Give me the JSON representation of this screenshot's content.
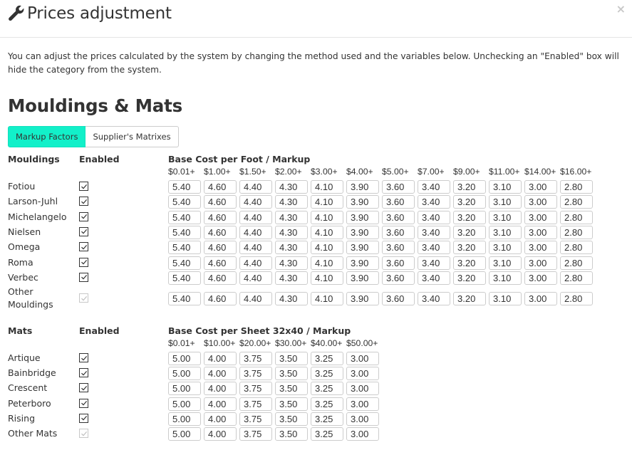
{
  "modal": {
    "title": "Prices adjustment",
    "title_icon": "wrench-icon",
    "close_label": "×",
    "description": "You can adjust the prices calculated by the system by changing the method used and the variables below. Unchecking an \"Enabled\" box will hide the category from the system."
  },
  "section": {
    "title": "Mouldings & Mats",
    "tabs": [
      {
        "label": "Markup Factors",
        "active": true
      },
      {
        "label": "Supplier's Matrixes",
        "active": false
      }
    ],
    "accent_color": "#12f0c9"
  },
  "mouldings": {
    "name_header": "Mouldings",
    "enabled_header": "Enabled",
    "cost_header": "Base Cost per Foot / Markup",
    "ranges": [
      "$0.01+",
      "$1.00+",
      "$1.50+",
      "$2.00+",
      "$3.00+",
      "$4.00+",
      "$5.00+",
      "$7.00+",
      "$9.00+",
      "$11.00+",
      "$14.00+",
      "$16.00+"
    ],
    "rows": [
      {
        "name": "Fotiou",
        "enabled": true,
        "disabled": false,
        "values": [
          "5.40",
          "4.60",
          "4.40",
          "4.30",
          "4.10",
          "3.90",
          "3.60",
          "3.40",
          "3.20",
          "3.10",
          "3.00",
          "2.80"
        ]
      },
      {
        "name": "Larson-Juhl",
        "enabled": true,
        "disabled": false,
        "values": [
          "5.40",
          "4.60",
          "4.40",
          "4.30",
          "4.10",
          "3.90",
          "3.60",
          "3.40",
          "3.20",
          "3.10",
          "3.00",
          "2.80"
        ]
      },
      {
        "name": "Michelangelo",
        "enabled": true,
        "disabled": false,
        "values": [
          "5.40",
          "4.60",
          "4.40",
          "4.30",
          "4.10",
          "3.90",
          "3.60",
          "3.40",
          "3.20",
          "3.10",
          "3.00",
          "2.80"
        ]
      },
      {
        "name": "Nielsen",
        "enabled": true,
        "disabled": false,
        "values": [
          "5.40",
          "4.60",
          "4.40",
          "4.30",
          "4.10",
          "3.90",
          "3.60",
          "3.40",
          "3.20",
          "3.10",
          "3.00",
          "2.80"
        ]
      },
      {
        "name": "Omega",
        "enabled": true,
        "disabled": false,
        "values": [
          "5.40",
          "4.60",
          "4.40",
          "4.30",
          "4.10",
          "3.90",
          "3.60",
          "3.40",
          "3.20",
          "3.10",
          "3.00",
          "2.80"
        ]
      },
      {
        "name": "Roma",
        "enabled": true,
        "disabled": false,
        "values": [
          "5.40",
          "4.60",
          "4.40",
          "4.30",
          "4.10",
          "3.90",
          "3.60",
          "3.40",
          "3.20",
          "3.10",
          "3.00",
          "2.80"
        ]
      },
      {
        "name": "Verbec",
        "enabled": true,
        "disabled": false,
        "values": [
          "5.40",
          "4.60",
          "4.40",
          "4.30",
          "4.10",
          "3.90",
          "3.60",
          "3.40",
          "3.20",
          "3.10",
          "3.00",
          "2.80"
        ]
      },
      {
        "name": "Other Mouldings",
        "name_lines": [
          "Other",
          "Mouldings"
        ],
        "enabled": true,
        "disabled": true,
        "values": [
          "5.40",
          "4.60",
          "4.40",
          "4.30",
          "4.10",
          "3.90",
          "3.60",
          "3.40",
          "3.20",
          "3.10",
          "3.00",
          "2.80"
        ]
      }
    ]
  },
  "mats": {
    "name_header": "Mats",
    "enabled_header": "Enabled",
    "cost_header": "Base Cost per Sheet 32x40 / Markup",
    "ranges": [
      "$0.01+",
      "$10.00+",
      "$20.00+",
      "$30.00+",
      "$40.00+",
      "$50.00+"
    ],
    "rows": [
      {
        "name": "Artique",
        "enabled": true,
        "disabled": false,
        "values": [
          "5.00",
          "4.00",
          "3.75",
          "3.50",
          "3.25",
          "3.00"
        ]
      },
      {
        "name": "Bainbridge",
        "enabled": true,
        "disabled": false,
        "values": [
          "5.00",
          "4.00",
          "3.75",
          "3.50",
          "3.25",
          "3.00"
        ]
      },
      {
        "name": "Crescent",
        "enabled": true,
        "disabled": false,
        "values": [
          "5.00",
          "4.00",
          "3.75",
          "3.50",
          "3.25",
          "3.00"
        ]
      },
      {
        "name": "Peterboro",
        "enabled": true,
        "disabled": false,
        "values": [
          "5.00",
          "4.00",
          "3.75",
          "3.50",
          "3.25",
          "3.00"
        ]
      },
      {
        "name": "Rising",
        "enabled": true,
        "disabled": false,
        "values": [
          "5.00",
          "4.00",
          "3.75",
          "3.50",
          "3.25",
          "3.00"
        ]
      },
      {
        "name": "Other Mats",
        "enabled": true,
        "disabled": true,
        "values": [
          "5.00",
          "4.00",
          "3.75",
          "3.50",
          "3.25",
          "3.00"
        ]
      }
    ]
  }
}
